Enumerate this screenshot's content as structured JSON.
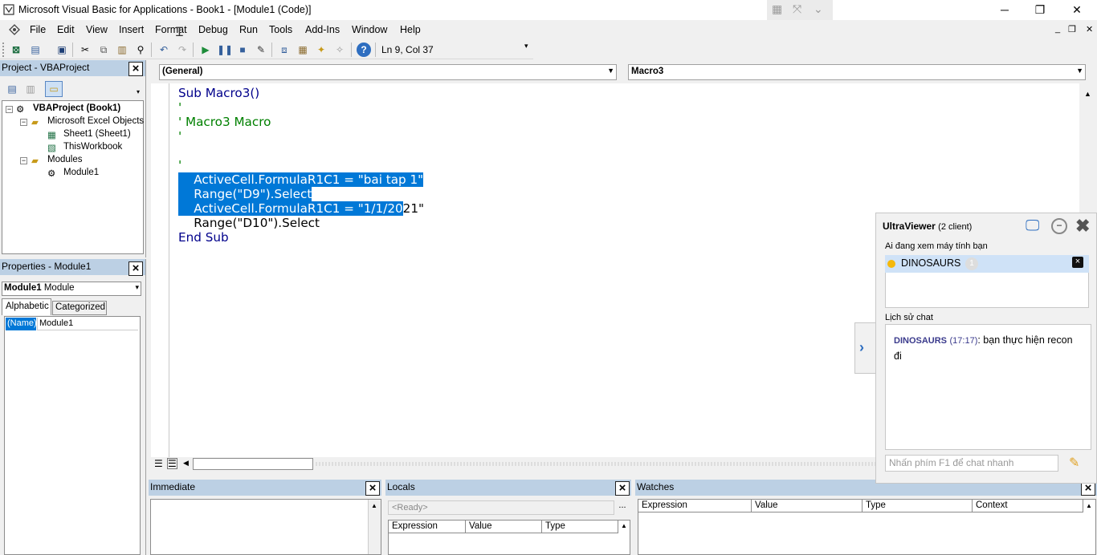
{
  "window": {
    "title": "Microsoft Visual Basic for Applications - Book1 - [Module1 (Code)]",
    "minimize": "─",
    "maximize": "❐",
    "close": "✕"
  },
  "menu": {
    "items": [
      "File",
      "Edit",
      "View",
      "Insert",
      "Format",
      "Debug",
      "Run",
      "Tools",
      "Add-Ins",
      "Window",
      "Help"
    ],
    "mdi_min": "_",
    "mdi_restore": "❐",
    "mdi_close": "✕"
  },
  "toolbar": {
    "position": "Ln 9, Col 37",
    "icons": [
      "excel-icon",
      "insert-module-icon",
      "save-icon",
      "cut-icon",
      "copy-icon",
      "paste-icon",
      "find-icon",
      "undo-icon",
      "redo-icon",
      "run-icon",
      "break-icon",
      "reset-icon",
      "design-mode-icon",
      "project-explorer-icon",
      "properties-icon",
      "object-browser-icon",
      "toolbox-icon",
      "help-icon"
    ]
  },
  "project_panel": {
    "title": "Project - VBAProject",
    "tree": {
      "root": "VBAProject (Book1)",
      "folder1": "Microsoft Excel Objects",
      "sheet1": "Sheet1 (Sheet1)",
      "thisworkbook": "ThisWorkbook",
      "folder2": "Modules",
      "module1": "Module1"
    }
  },
  "properties_panel": {
    "title": "Properties - Module1",
    "object_bold": "Module1",
    "object_type": "Module",
    "tab_alphabetic": "Alphabetic",
    "tab_categorized": "Categorized",
    "prop_name": "(Name)",
    "prop_value": "Module1"
  },
  "code_window": {
    "object_combo": "(General)",
    "proc_combo": "Macro3",
    "lines": {
      "l1": "Sub Macro3()",
      "l2": "'",
      "l3": "' Macro3 Macro",
      "l4": "'",
      "l6": "'",
      "l7": "    ActiveCell.FormulaR1C1 = \"bai tap 1\"",
      "l8": "    Range(\"D9\").Select",
      "l9_sel": "    ActiveCell.FormulaR1C1 = \"1/1/20",
      "l9_rest": "21\"",
      "l10": "    Range(\"D10\").Select",
      "l11": "End Sub"
    }
  },
  "immediate": {
    "title": "Immediate"
  },
  "locals": {
    "title": "Locals",
    "status": "<Ready>",
    "browse": "...",
    "columns": [
      "Expression",
      "Value",
      "Type"
    ]
  },
  "watches": {
    "title": "Watches",
    "columns": [
      "Expression",
      "Value",
      "Type",
      "Context"
    ]
  },
  "ultraviewer": {
    "title": "UltraViewer",
    "clients": "(2 client)",
    "viewing_label": "Ai đang xem máy tính bạn",
    "user_name": "DINOSAURS",
    "user_badge": "1",
    "chat_history_label": "Lịch sử chat",
    "chat_sender": "DINOSAURS",
    "chat_time": "(17:17)",
    "chat_message": ": bạn thực hiện recon đi",
    "input_placeholder": "Nhấn phím F1 để chat nhanh"
  },
  "colors": {
    "panel_header": "#bcd0e4",
    "selection": "#0078d7",
    "keyword": "#00008b",
    "comment": "#008000"
  }
}
